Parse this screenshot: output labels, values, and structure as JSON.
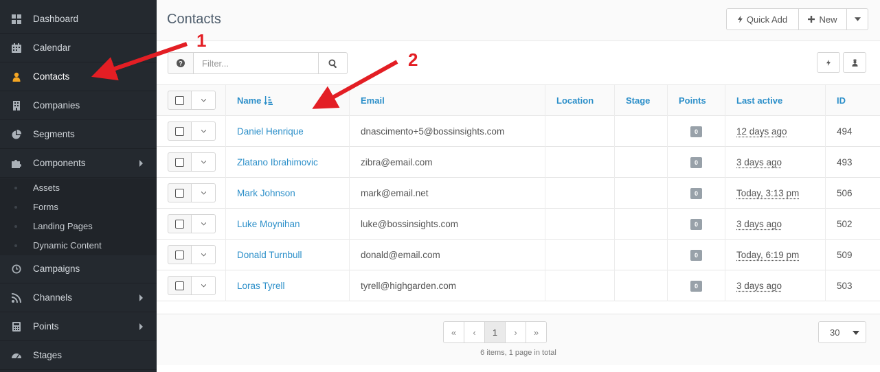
{
  "sidebar": {
    "items": [
      {
        "label": "Dashboard",
        "icon": "dashboard-icon"
      },
      {
        "label": "Calendar",
        "icon": "calendar-icon"
      },
      {
        "label": "Contacts",
        "icon": "user-icon",
        "active": true
      },
      {
        "label": "Companies",
        "icon": "building-icon"
      },
      {
        "label": "Segments",
        "icon": "pie-chart-icon"
      },
      {
        "label": "Components",
        "icon": "puzzle-icon",
        "has_submenu": true
      },
      {
        "label": "Campaigns",
        "icon": "clock-icon"
      },
      {
        "label": "Channels",
        "icon": "rss-icon",
        "has_submenu": true
      },
      {
        "label": "Points",
        "icon": "calculator-icon",
        "has_submenu": true
      },
      {
        "label": "Stages",
        "icon": "tachometer-icon"
      }
    ],
    "components_submenu": [
      "Assets",
      "Forms",
      "Landing Pages",
      "Dynamic Content"
    ]
  },
  "header": {
    "title": "Contacts",
    "quick_add_label": "Quick Add",
    "new_label": "New"
  },
  "filter": {
    "placeholder": "Filter..."
  },
  "table": {
    "columns": [
      "Name",
      "Email",
      "Location",
      "Stage",
      "Points",
      "Last active",
      "ID"
    ],
    "sort_column": "Name",
    "rows": [
      {
        "name": "Daniel Henrique",
        "email": "dnascimento+5@bossinsights.com",
        "location": "",
        "stage": "",
        "points": "0",
        "last_active": "12 days ago",
        "id": "494"
      },
      {
        "name": "Zlatano Ibrahimovic",
        "email": "zibra@email.com",
        "location": "",
        "stage": "",
        "points": "0",
        "last_active": "3 days ago",
        "id": "493"
      },
      {
        "name": "Mark Johnson",
        "email": "mark@email.net",
        "location": "",
        "stage": "",
        "points": "0",
        "last_active": "Today, 3:13 pm",
        "id": "506"
      },
      {
        "name": "Luke Moynihan",
        "email": "luke@bossinsights.com",
        "location": "",
        "stage": "",
        "points": "0",
        "last_active": "3 days ago",
        "id": "502"
      },
      {
        "name": "Donald Turnbull",
        "email": "donald@email.com",
        "location": "",
        "stage": "",
        "points": "0",
        "last_active": "Today, 6:19 pm",
        "id": "509"
      },
      {
        "name": "Loras Tyrell",
        "email": "tyrell@highgarden.com",
        "location": "",
        "stage": "",
        "points": "0",
        "last_active": "3 days ago",
        "id": "503"
      }
    ]
  },
  "pagination": {
    "buttons": [
      "«",
      "‹",
      "1",
      "›",
      "»"
    ],
    "current_page": "1",
    "summary": "6 items, 1 page in total",
    "per_page": "30"
  },
  "annotations": {
    "marker_1": "1",
    "marker_2": "2",
    "color": "#e31e24"
  },
  "colors": {
    "sidebar_bg": "#24292f",
    "active_icon": "#f5a623",
    "link": "#2c8fc9"
  }
}
